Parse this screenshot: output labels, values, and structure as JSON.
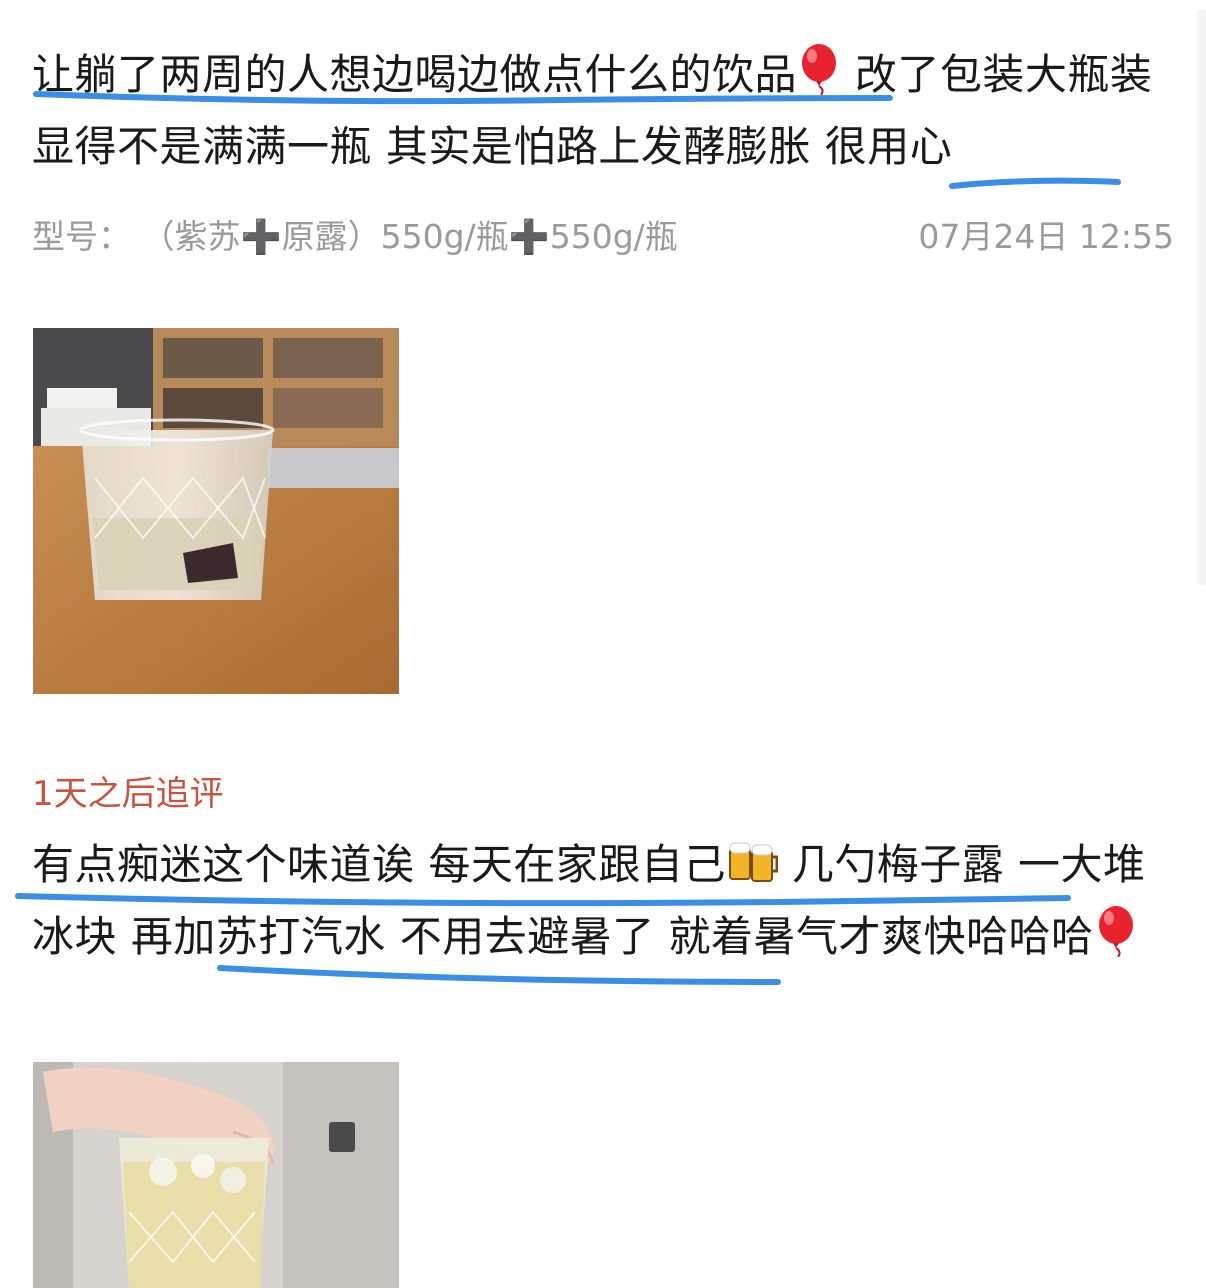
{
  "review": {
    "text_part1": "让躺了两周的人想边喝边做点什么的饮品",
    "balloon_icon": "balloon-icon",
    "text_part2": "  改了包装大瓶装显得不是满满一瓶 其实是怕路上发酵膨胀 很用心",
    "spec_label": "型号：",
    "spec_value_a": "（紫苏",
    "spec_plus": "➕",
    "spec_value_b": "原露）550g/瓶",
    "spec_value_c": "550g/瓶",
    "date": "07月24日 12:55"
  },
  "followup": {
    "label": "1天之后追评",
    "text_part1": "有点痴迷这个味道诶 每天在家跟自己",
    "beer_icon": "beer-mugs-icon",
    "text_part2": " 几勺梅子露 一大堆冰块 再加苏打汽水 不用去避暑了 就着暑气才爽快哈哈哈"
  },
  "colors": {
    "underline": "#3a8ee6",
    "followup_label": "#c8543f",
    "meta_text": "#9a9a9a",
    "balloon": "#e8232e"
  },
  "photos": [
    {
      "icon": "glass-on-table-photo"
    },
    {
      "icon": "hand-holding-glass-photo"
    }
  ]
}
